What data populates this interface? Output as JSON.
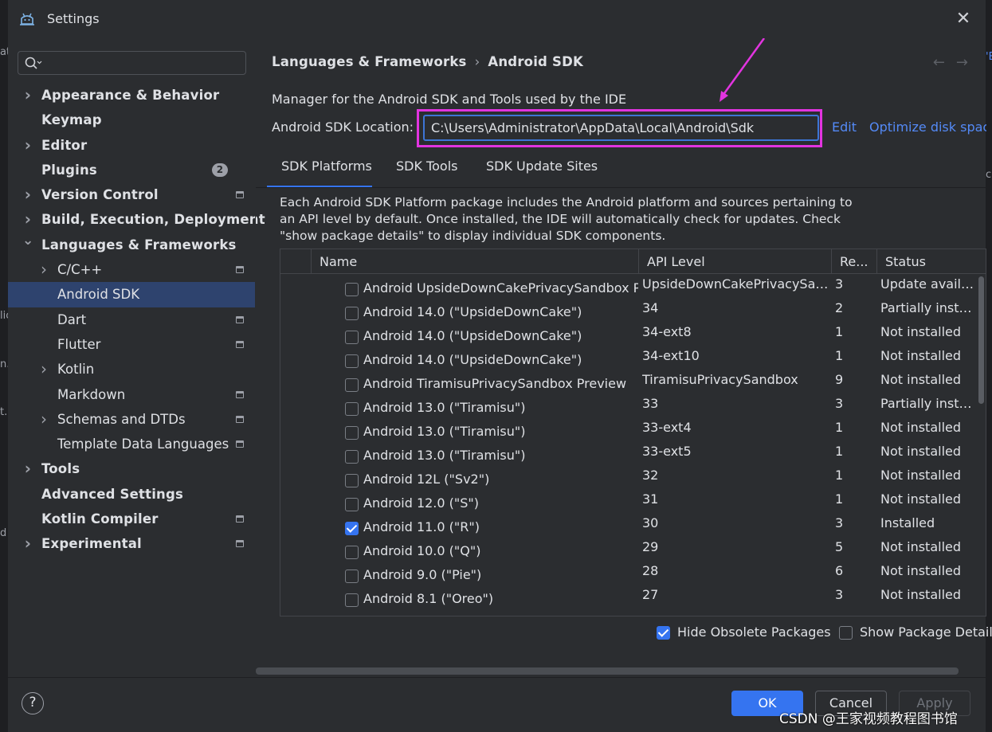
{
  "window": {
    "title": "Settings"
  },
  "sidebar": {
    "search_placeholder": "",
    "items": [
      {
        "label": "Appearance & Behavior",
        "expandable": true,
        "bold": true
      },
      {
        "label": "Keymap",
        "expandable": false,
        "bold": true
      },
      {
        "label": "Editor",
        "expandable": true,
        "bold": true
      },
      {
        "label": "Plugins",
        "expandable": false,
        "bold": true,
        "badge": "2"
      },
      {
        "label": "Version Control",
        "expandable": true,
        "bold": true,
        "module_icon": true
      },
      {
        "label": "Build, Execution, Deployment",
        "expandable": true,
        "bold": true
      },
      {
        "label": "Languages & Frameworks",
        "expandable": true,
        "expanded": true,
        "bold": true
      },
      {
        "label": "C/C++",
        "expandable": true,
        "child": true,
        "module_icon": true
      },
      {
        "label": "Android SDK",
        "child": true,
        "selected": true
      },
      {
        "label": "Dart",
        "child": true,
        "module_icon": true
      },
      {
        "label": "Flutter",
        "child": true,
        "module_icon": true
      },
      {
        "label": "Kotlin",
        "expandable": true,
        "child": true
      },
      {
        "label": "Markdown",
        "child": true,
        "module_icon": true
      },
      {
        "label": "Schemas and DTDs",
        "expandable": true,
        "child": true,
        "module_icon": true
      },
      {
        "label": "Template Data Languages",
        "child": true,
        "module_icon": true
      },
      {
        "label": "Tools",
        "expandable": true,
        "bold": true
      },
      {
        "label": "Advanced Settings",
        "bold": true
      },
      {
        "label": "Kotlin Compiler",
        "bold": true,
        "module_icon": true
      },
      {
        "label": "Experimental",
        "expandable": true,
        "bold": true,
        "module_icon": true
      }
    ]
  },
  "breadcrumb": {
    "parent": "Languages & Frameworks",
    "separator": "›",
    "current": "Android SDK"
  },
  "description": "Manager for the Android SDK and Tools used by the IDE",
  "sdk_location": {
    "label": "Android SDK Location:",
    "value": "C:\\Users\\Administrator\\AppData\\Local\\Android\\Sdk",
    "edit_label": "Edit",
    "optimize_label": "Optimize disk spac"
  },
  "tabs": [
    {
      "label": "SDK Platforms",
      "active": true
    },
    {
      "label": "SDK Tools",
      "active": false
    },
    {
      "label": "SDK Update Sites",
      "active": false
    }
  ],
  "info_text": "Each Android SDK Platform package includes the Android platform and sources pertaining to an API level by default. Once installed, the IDE will automatically check for updates. Check \"show package details\" to display individual SDK components.",
  "table": {
    "columns": [
      "Name",
      "API Level",
      "Re...",
      "Status"
    ],
    "rows": [
      {
        "checked": false,
        "name": "Android UpsideDownCakePrivacySandbox Pr",
        "api": "UpsideDownCakePrivacySan...",
        "rev": "3",
        "status": "Update availa..."
      },
      {
        "checked": false,
        "name": "Android 14.0 (\"UpsideDownCake\")",
        "api": "34",
        "rev": "2",
        "status": "Partially instal..."
      },
      {
        "checked": false,
        "name": "Android 14.0 (\"UpsideDownCake\")",
        "api": "34-ext8",
        "rev": "1",
        "status": "Not installed"
      },
      {
        "checked": false,
        "name": "Android 14.0 (\"UpsideDownCake\")",
        "api": "34-ext10",
        "rev": "1",
        "status": "Not installed"
      },
      {
        "checked": false,
        "name": "Android TiramisuPrivacySandbox Preview",
        "api": "TiramisuPrivacySandbox",
        "rev": "9",
        "status": "Not installed"
      },
      {
        "checked": false,
        "name": "Android 13.0 (\"Tiramisu\")",
        "api": "33",
        "rev": "3",
        "status": "Partially instal..."
      },
      {
        "checked": false,
        "name": "Android 13.0 (\"Tiramisu\")",
        "api": "33-ext4",
        "rev": "1",
        "status": "Not installed"
      },
      {
        "checked": false,
        "name": "Android 13.0 (\"Tiramisu\")",
        "api": "33-ext5",
        "rev": "1",
        "status": "Not installed"
      },
      {
        "checked": false,
        "name": "Android 12L (\"Sv2\")",
        "api": "32",
        "rev": "1",
        "status": "Not installed"
      },
      {
        "checked": false,
        "name": "Android 12.0 (\"S\")",
        "api": "31",
        "rev": "1",
        "status": "Not installed"
      },
      {
        "checked": true,
        "name": "Android 11.0 (\"R\")",
        "api": "30",
        "rev": "3",
        "status": "Installed"
      },
      {
        "checked": false,
        "name": "Android 10.0 (\"Q\")",
        "api": "29",
        "rev": "5",
        "status": "Not installed"
      },
      {
        "checked": false,
        "name": "Android 9.0 (\"Pie\")",
        "api": "28",
        "rev": "6",
        "status": "Not installed"
      },
      {
        "checked": false,
        "name": "Android 8.1 (\"Oreo\")",
        "api": "27",
        "rev": "3",
        "status": "Not installed"
      }
    ]
  },
  "options": {
    "hide_obsolete": {
      "label": "Hide Obsolete Packages",
      "checked": true
    },
    "show_details": {
      "label": "Show Package Details",
      "checked": false
    }
  },
  "footer": {
    "help": "?",
    "ok": "OK",
    "cancel": "Cancel",
    "apply": "Apply"
  },
  "watermark": "CSDN @王家视频教程图书馆",
  "background_fragments": {
    "left": [
      "at",
      "lic",
      "n.A",
      "t.:",
      "d"
    ],
    "right": [
      "'E",
      "ch"
    ]
  },
  "colors": {
    "accent": "#3574f0",
    "link": "#548af7",
    "highlight_outline": "#e234e0",
    "selected_row": "#2e436e"
  }
}
